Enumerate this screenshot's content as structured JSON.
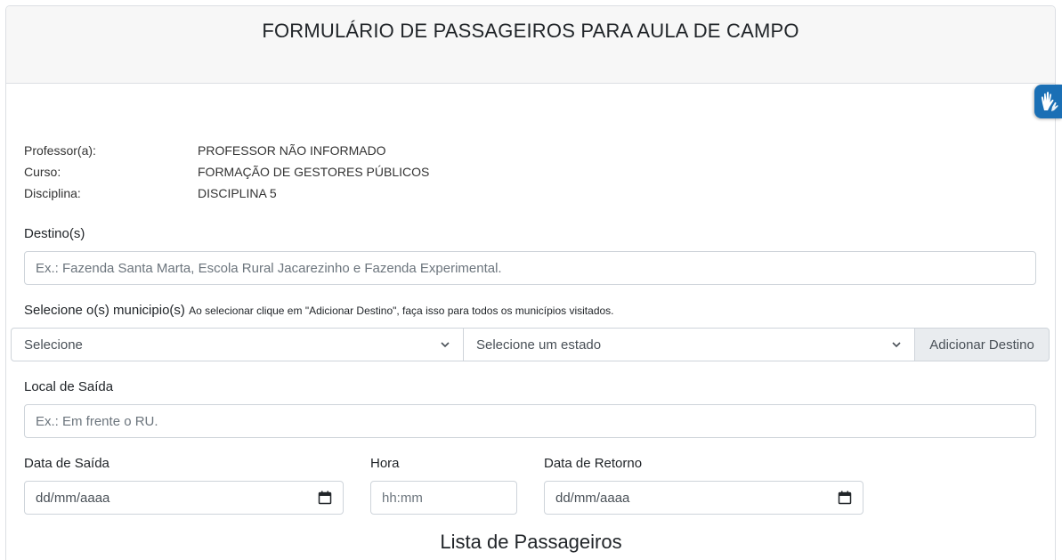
{
  "header": {
    "title": "FORMULÁRIO DE PASSAGEIROS PARA AULA DE CAMPO"
  },
  "info": [
    {
      "label": "Professor(a):",
      "value": "PROFESSOR NÃO INFORMADO"
    },
    {
      "label": "Curso:",
      "value": "FORMAÇÃO DE GESTORES PÚBLICOS"
    },
    {
      "label": "Disciplina:",
      "value": "DISCIPLINA 5"
    }
  ],
  "destino": {
    "label": "Destino(s)",
    "placeholder": "Ex.: Fazenda Santa Marta, Escola Rural Jacarezinho e Fazenda Experimental."
  },
  "municipios": {
    "label": "Selecione o(s) municipio(s)",
    "hint": "Ao selecionar clique em \"Adicionar Destino\", faça isso para todos os municípios visitados.",
    "select_municipio": "Selecione",
    "select_estado": "Selecione um estado",
    "add_button": "Adicionar Destino"
  },
  "local_saida": {
    "label": "Local de Saída",
    "placeholder": "Ex.: Em frente o RU."
  },
  "data_saida": {
    "label": "Data de Saída",
    "placeholder": "dd/mm/aaaa"
  },
  "hora": {
    "label": "Hora",
    "placeholder": "hh:mm"
  },
  "data_retorno": {
    "label": "Data de Retorno",
    "placeholder": "dd/mm/aaaa"
  },
  "passageiros": {
    "title": "Lista de Passageiros"
  },
  "icons": {
    "accessibility": "sign-language-hands-icon",
    "calendar": "calendar-icon",
    "dropdown": "chevron-down-icon"
  },
  "colors": {
    "accessibility_widget": "#1a6fb5",
    "header_bg": "#f7f7f7"
  }
}
